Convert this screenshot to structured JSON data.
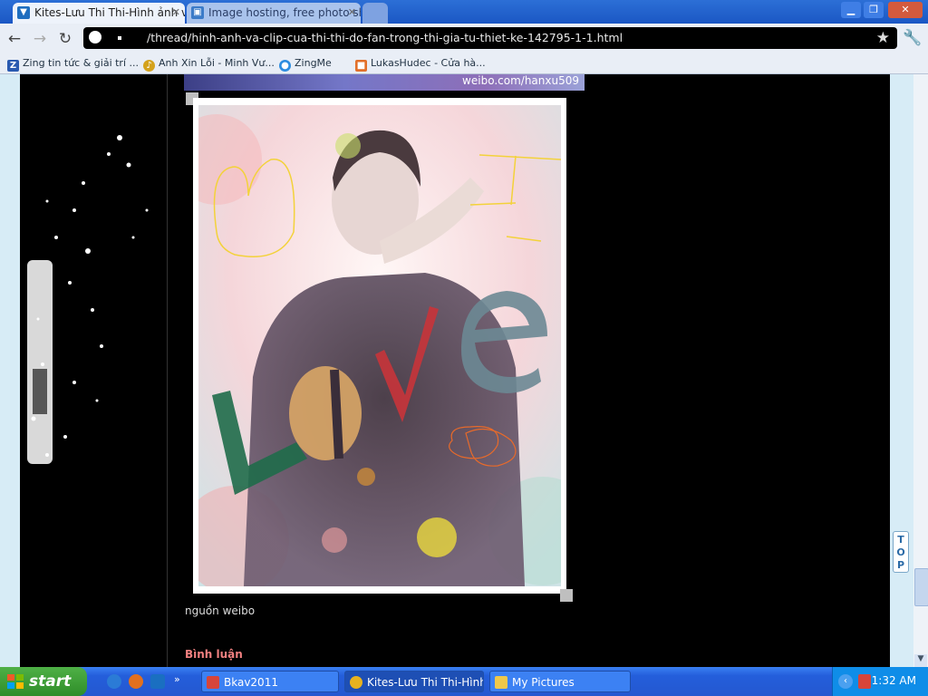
{
  "browser": {
    "tabs": [
      {
        "title": "Kites-Lưu Thi Thi-Hình ảnh và",
        "active": true
      },
      {
        "title": "Image hosting, free photo sha",
        "active": false
      }
    ],
    "address": "/thread/hinh-anh-va-clip-cua-thi-thi-do-fan-trong-thi-gia-tu-thiet-ke-142795-1-1.html",
    "bookmarks": [
      "Zing tin tức & giải trí ...",
      "Anh Xin Lỗi - Minh Vư...",
      "ZingMe",
      "LukasHudec - Cửa hà..."
    ]
  },
  "page": {
    "image_credit": "weibo.com/hanxu509",
    "photo_letters": [
      "L",
      "O",
      "V",
      "e",
      "I"
    ],
    "caption": "nguồn weibo",
    "comment_heading": "Bình luận",
    "top_button": "TOP"
  },
  "taskbar": {
    "start_label": "start",
    "tasks": [
      {
        "label": "Bkav2011",
        "active": false
      },
      {
        "label": "Kites-Lưu Thi Thi-Hình...",
        "active": true
      },
      {
        "label": "My Pictures",
        "active": false
      }
    ],
    "clock": "1:32 AM"
  },
  "colors": {
    "titlebar": "#1b57c4",
    "taskbar": "#245edb",
    "start_green": "#2f8d29",
    "comment_heading": "#f08080"
  }
}
